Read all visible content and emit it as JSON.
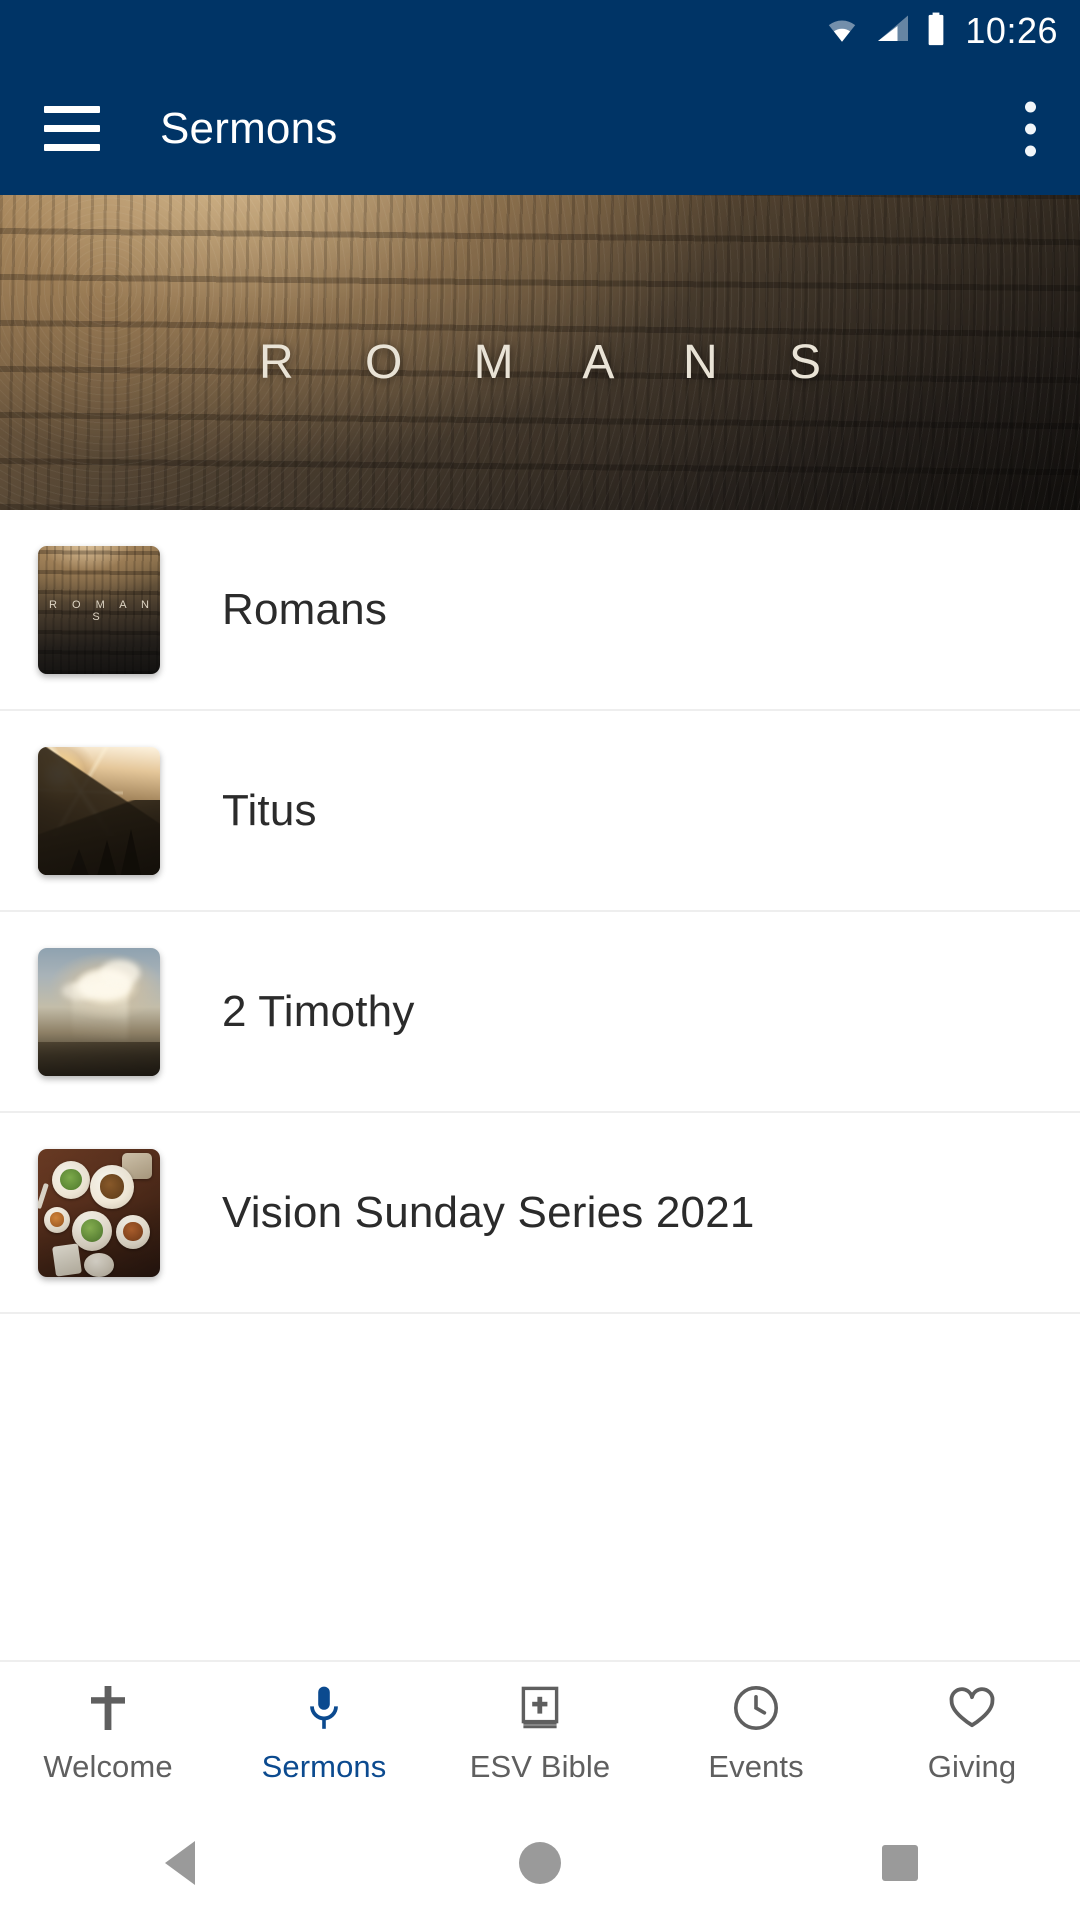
{
  "status_bar": {
    "time": "10:26",
    "icons": [
      "wifi-icon",
      "cellular-signal-icon",
      "battery-icon"
    ]
  },
  "app_bar": {
    "menu_icon": "hamburger-menu-icon",
    "title": "Sermons",
    "overflow_icon": "more-vertical-icon",
    "background_color": "#003466",
    "text_color": "#ffffff"
  },
  "hero": {
    "title": "ROMANS",
    "spaced_title": "R O M A N S"
  },
  "series": [
    {
      "label": "Romans",
      "thumb_caption": "R O M A N S",
      "art": "art-romans"
    },
    {
      "label": "Titus",
      "thumb_caption": "",
      "art": "art-titus"
    },
    {
      "label": "2 Timothy",
      "thumb_caption": "",
      "art": "art-timothy"
    },
    {
      "label": "Vision Sunday Series 2021",
      "thumb_caption": "",
      "art": "art-vision"
    }
  ],
  "bottom_nav": {
    "active_index": 1,
    "active_color": "#0b4a8f",
    "inactive_color": "#5f5f5f",
    "items": [
      {
        "label": "Welcome",
        "icon": "cross-icon"
      },
      {
        "label": "Sermons",
        "icon": "microphone-icon"
      },
      {
        "label": "ESV Bible",
        "icon": "bible-book-icon"
      },
      {
        "label": "Events",
        "icon": "clock-icon"
      },
      {
        "label": "Giving",
        "icon": "heart-icon"
      }
    ]
  },
  "system_nav": {
    "back": "back-triangle-icon",
    "home": "home-circle-icon",
    "recents": "recents-square-icon"
  }
}
